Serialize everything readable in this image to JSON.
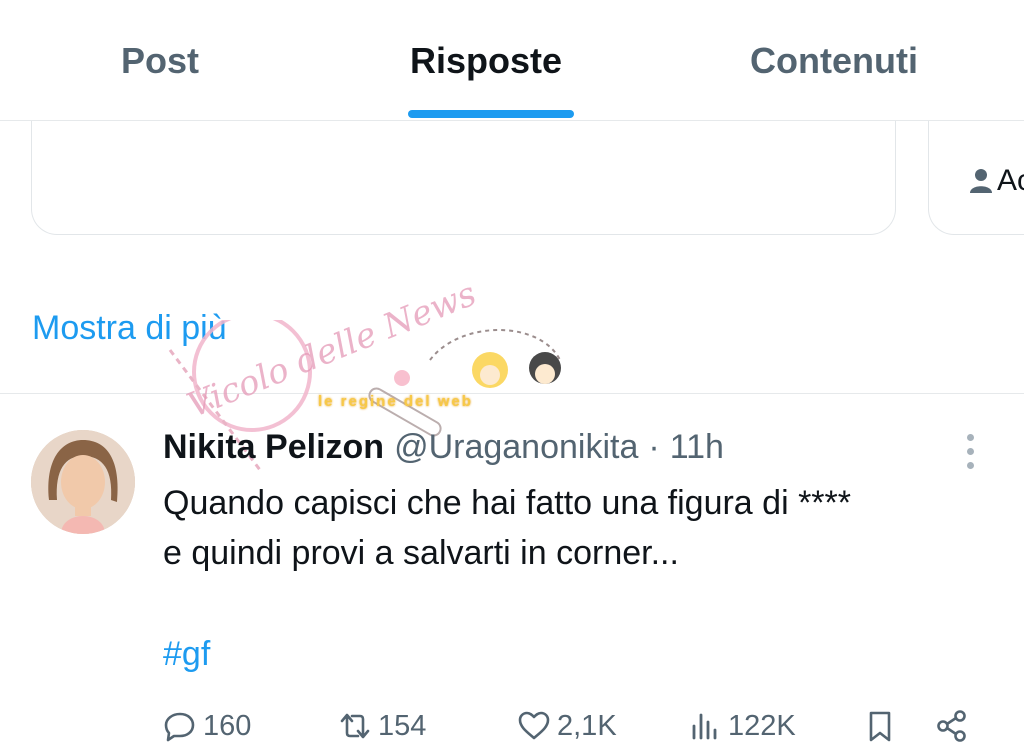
{
  "tabs": [
    {
      "label": "Post",
      "active": false
    },
    {
      "label": "Risposte",
      "active": true
    },
    {
      "label": "Contenuti",
      "active": false
    }
  ],
  "accent_color": "#1d9bf0",
  "right_card": {
    "label": "Ac",
    "icon": "person-icon"
  },
  "show_more": "Mostra di più",
  "watermark": {
    "script_text": "Vicolo delle News",
    "band_text": "le regine del web"
  },
  "tweet": {
    "author_name": "Nikita Pelizon",
    "handle": "@Uraganonikita",
    "separator": "·",
    "time": "11h",
    "text_line1": "Quando capisci che hai fatto una figura di ****",
    "text_line2": "e quindi provi a salvarti in corner...",
    "hashtag": "#gf",
    "replies": "160",
    "retweets": "154",
    "likes": "2,1K",
    "views": "122K"
  }
}
